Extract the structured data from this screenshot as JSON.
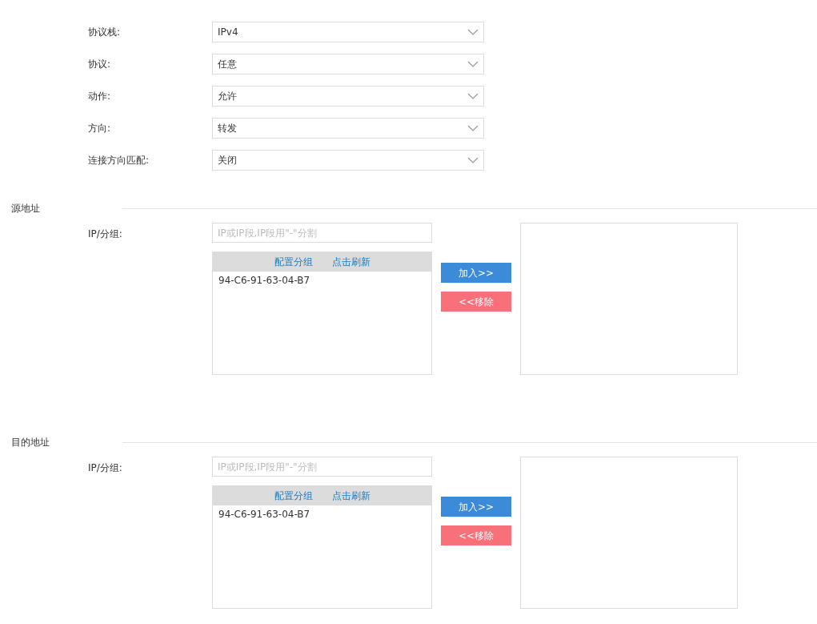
{
  "settings": [
    {
      "label": "协议栈:",
      "value": "IPv4"
    },
    {
      "label": "协议:",
      "value": "任意"
    },
    {
      "label": "动作:",
      "value": "允许"
    },
    {
      "label": "方向:",
      "value": "转发"
    },
    {
      "label": "连接方向匹配:",
      "value": "关闭"
    }
  ],
  "sections": [
    {
      "title": "源地址",
      "field_label": "IP/分组:",
      "placeholder": "IP或IP段,IP段用\"-\"分割",
      "links": [
        "配置分组",
        "点击刷新"
      ],
      "items": [
        "94-C6-91-63-04-B7"
      ],
      "add_button": "加入>>",
      "remove_button": "<<移除"
    },
    {
      "title": "目的地址",
      "field_label": "IP/分组:",
      "placeholder": "IP或IP段,IP段用\"-\"分割",
      "links": [
        "配置分组",
        "点击刷新"
      ],
      "items": [
        "94-C6-91-63-04-B7"
      ],
      "add_button": "加入>>",
      "remove_button": "<<移除"
    }
  ]
}
